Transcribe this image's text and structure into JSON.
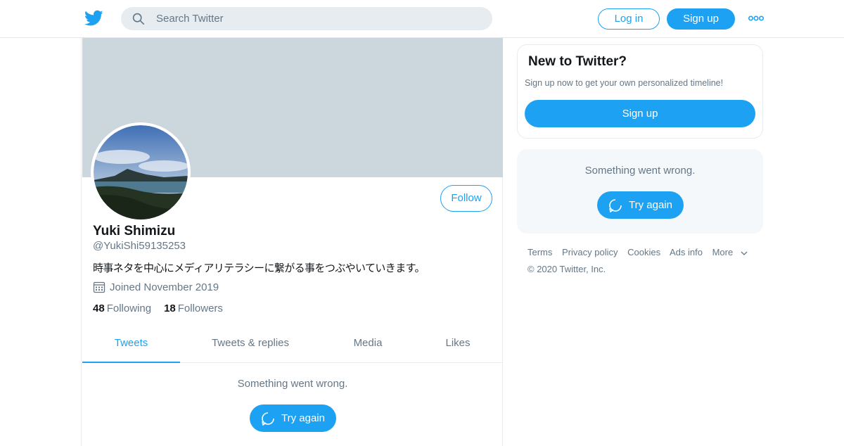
{
  "header": {
    "logo_icon": "twitter-bird-icon",
    "search_placeholder": "Search Twitter",
    "login_label": "Log in",
    "signup_label": "Sign up",
    "more_icon": "more-dots-icon"
  },
  "profile": {
    "name": "Yuki Shimizu",
    "handle": "@YukiShi59135253",
    "bio": "時事ネタを中心にメディアリテラシーに繋がる事をつぶやいていきます。",
    "joined": "Joined November 2019",
    "following_count": "48",
    "following_label": "Following",
    "followers_count": "18",
    "followers_label": "Followers",
    "follow_label": "Follow"
  },
  "tabs": [
    {
      "label": "Tweets"
    },
    {
      "label": "Tweets & replies"
    },
    {
      "label": "Media"
    },
    {
      "label": "Likes"
    }
  ],
  "timeline": {
    "error_text": "Something went wrong.",
    "retry_label": "Try again"
  },
  "sidebar": {
    "new_title": "New to Twitter?",
    "new_sub": "Sign up now to get your own personalized timeline!",
    "signup_label": "Sign up",
    "error_text": "Something went wrong.",
    "retry_label": "Try again",
    "footer_links": [
      "Terms",
      "Privacy policy",
      "Cookies",
      "Ads info",
      "More"
    ],
    "copyright": "© 2020 Twitter, Inc."
  },
  "colors": {
    "accent": "#1da1f2",
    "banner": "#ccd6dd",
    "muted_text": "#657786"
  }
}
